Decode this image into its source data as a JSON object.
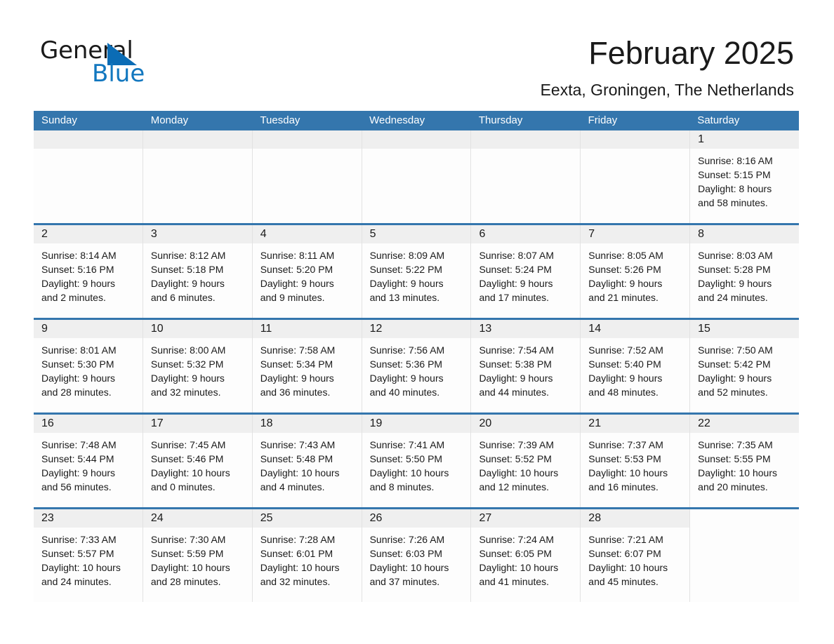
{
  "brand": {
    "name_part1": "General",
    "name_part2": "Blue",
    "logo_icon": "blue-triangle-icon",
    "accent_color": "#1277bf"
  },
  "header": {
    "title": "February 2025",
    "subtitle": "Eexta, Groningen, The Netherlands"
  },
  "calendar": {
    "header_bg": "#3476ad",
    "day_band_bg": "#efefef",
    "weekdays": [
      "Sunday",
      "Monday",
      "Tuesday",
      "Wednesday",
      "Thursday",
      "Friday",
      "Saturday"
    ],
    "weeks": [
      [
        {
          "day": "",
          "lines": []
        },
        {
          "day": "",
          "lines": []
        },
        {
          "day": "",
          "lines": []
        },
        {
          "day": "",
          "lines": []
        },
        {
          "day": "",
          "lines": []
        },
        {
          "day": "",
          "lines": []
        },
        {
          "day": "1",
          "lines": [
            "Sunrise: 8:16 AM",
            "Sunset: 5:15 PM",
            "Daylight: 8 hours",
            "and 58 minutes."
          ]
        }
      ],
      [
        {
          "day": "2",
          "lines": [
            "Sunrise: 8:14 AM",
            "Sunset: 5:16 PM",
            "Daylight: 9 hours",
            "and 2 minutes."
          ]
        },
        {
          "day": "3",
          "lines": [
            "Sunrise: 8:12 AM",
            "Sunset: 5:18 PM",
            "Daylight: 9 hours",
            "and 6 minutes."
          ]
        },
        {
          "day": "4",
          "lines": [
            "Sunrise: 8:11 AM",
            "Sunset: 5:20 PM",
            "Daylight: 9 hours",
            "and 9 minutes."
          ]
        },
        {
          "day": "5",
          "lines": [
            "Sunrise: 8:09 AM",
            "Sunset: 5:22 PM",
            "Daylight: 9 hours",
            "and 13 minutes."
          ]
        },
        {
          "day": "6",
          "lines": [
            "Sunrise: 8:07 AM",
            "Sunset: 5:24 PM",
            "Daylight: 9 hours",
            "and 17 minutes."
          ]
        },
        {
          "day": "7",
          "lines": [
            "Sunrise: 8:05 AM",
            "Sunset: 5:26 PM",
            "Daylight: 9 hours",
            "and 21 minutes."
          ]
        },
        {
          "day": "8",
          "lines": [
            "Sunrise: 8:03 AM",
            "Sunset: 5:28 PM",
            "Daylight: 9 hours",
            "and 24 minutes."
          ]
        }
      ],
      [
        {
          "day": "9",
          "lines": [
            "Sunrise: 8:01 AM",
            "Sunset: 5:30 PM",
            "Daylight: 9 hours",
            "and 28 minutes."
          ]
        },
        {
          "day": "10",
          "lines": [
            "Sunrise: 8:00 AM",
            "Sunset: 5:32 PM",
            "Daylight: 9 hours",
            "and 32 minutes."
          ]
        },
        {
          "day": "11",
          "lines": [
            "Sunrise: 7:58 AM",
            "Sunset: 5:34 PM",
            "Daylight: 9 hours",
            "and 36 minutes."
          ]
        },
        {
          "day": "12",
          "lines": [
            "Sunrise: 7:56 AM",
            "Sunset: 5:36 PM",
            "Daylight: 9 hours",
            "and 40 minutes."
          ]
        },
        {
          "day": "13",
          "lines": [
            "Sunrise: 7:54 AM",
            "Sunset: 5:38 PM",
            "Daylight: 9 hours",
            "and 44 minutes."
          ]
        },
        {
          "day": "14",
          "lines": [
            "Sunrise: 7:52 AM",
            "Sunset: 5:40 PM",
            "Daylight: 9 hours",
            "and 48 minutes."
          ]
        },
        {
          "day": "15",
          "lines": [
            "Sunrise: 7:50 AM",
            "Sunset: 5:42 PM",
            "Daylight: 9 hours",
            "and 52 minutes."
          ]
        }
      ],
      [
        {
          "day": "16",
          "lines": [
            "Sunrise: 7:48 AM",
            "Sunset: 5:44 PM",
            "Daylight: 9 hours",
            "and 56 minutes."
          ]
        },
        {
          "day": "17",
          "lines": [
            "Sunrise: 7:45 AM",
            "Sunset: 5:46 PM",
            "Daylight: 10 hours",
            "and 0 minutes."
          ]
        },
        {
          "day": "18",
          "lines": [
            "Sunrise: 7:43 AM",
            "Sunset: 5:48 PM",
            "Daylight: 10 hours",
            "and 4 minutes."
          ]
        },
        {
          "day": "19",
          "lines": [
            "Sunrise: 7:41 AM",
            "Sunset: 5:50 PM",
            "Daylight: 10 hours",
            "and 8 minutes."
          ]
        },
        {
          "day": "20",
          "lines": [
            "Sunrise: 7:39 AM",
            "Sunset: 5:52 PM",
            "Daylight: 10 hours",
            "and 12 minutes."
          ]
        },
        {
          "day": "21",
          "lines": [
            "Sunrise: 7:37 AM",
            "Sunset: 5:53 PM",
            "Daylight: 10 hours",
            "and 16 minutes."
          ]
        },
        {
          "day": "22",
          "lines": [
            "Sunrise: 7:35 AM",
            "Sunset: 5:55 PM",
            "Daylight: 10 hours",
            "and 20 minutes."
          ]
        }
      ],
      [
        {
          "day": "23",
          "lines": [
            "Sunrise: 7:33 AM",
            "Sunset: 5:57 PM",
            "Daylight: 10 hours",
            "and 24 minutes."
          ]
        },
        {
          "day": "24",
          "lines": [
            "Sunrise: 7:30 AM",
            "Sunset: 5:59 PM",
            "Daylight: 10 hours",
            "and 28 minutes."
          ]
        },
        {
          "day": "25",
          "lines": [
            "Sunrise: 7:28 AM",
            "Sunset: 6:01 PM",
            "Daylight: 10 hours",
            "and 32 minutes."
          ]
        },
        {
          "day": "26",
          "lines": [
            "Sunrise: 7:26 AM",
            "Sunset: 6:03 PM",
            "Daylight: 10 hours",
            "and 37 minutes."
          ]
        },
        {
          "day": "27",
          "lines": [
            "Sunrise: 7:24 AM",
            "Sunset: 6:05 PM",
            "Daylight: 10 hours",
            "and 41 minutes."
          ]
        },
        {
          "day": "28",
          "lines": [
            "Sunrise: 7:21 AM",
            "Sunset: 6:07 PM",
            "Daylight: 10 hours",
            "and 45 minutes."
          ]
        },
        {
          "day": "",
          "lines": []
        }
      ]
    ]
  }
}
